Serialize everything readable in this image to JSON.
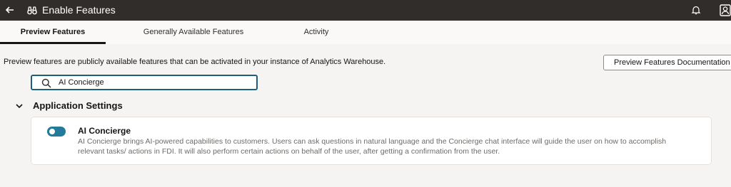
{
  "header": {
    "title": "Enable Features",
    "back_icon": "arrow-left-icon",
    "app_icon": "binoculars-icon",
    "notification_icon": "bell-icon",
    "user_icon": "user-avatar-icon"
  },
  "tabs": [
    {
      "label": "Preview Features",
      "active": true
    },
    {
      "label": "Generally Available Features",
      "active": false
    },
    {
      "label": "Activity",
      "active": false
    }
  ],
  "main": {
    "description": "Preview features are publicly available features that can be activated in your instance of Analytics Warehouse.",
    "doc_button": "Preview Features Documentation",
    "search": {
      "value": "AI Concierge",
      "icon": "search-icon"
    },
    "section": {
      "title": "Application Settings",
      "expanded": true
    },
    "features": [
      {
        "name": "AI Concierge",
        "enabled": true,
        "description": "AI Concierge brings AI-powered capabilities to customers. Users can ask questions in natural language and the Concierge chat interface will guide the user on how to accomplish relevant tasks/ actions in FDI. It will also perform certain actions on behalf of the user, after getting a confirmation from the user."
      }
    ]
  },
  "colors": {
    "header_bg": "#312d2a",
    "accent": "#237a9a",
    "focus_border": "#1e5d7c",
    "page_bg": "#f5f4f2"
  }
}
